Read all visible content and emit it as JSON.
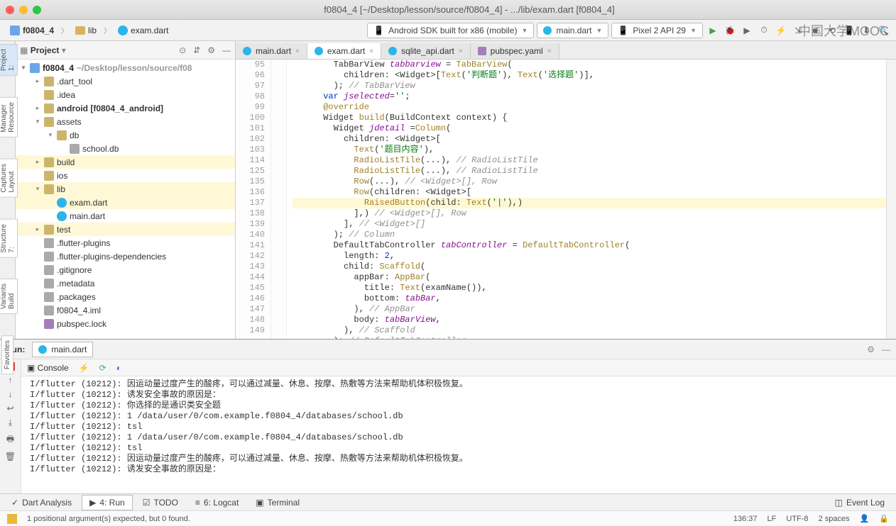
{
  "titlebar": "f0804_4 [~/Desktop/lesson/source/f0804_4] - .../lib/exam.dart [f0804_4]",
  "breadcrumbs": [
    "f0804_4",
    "lib",
    "exam.dart"
  ],
  "device_combo": "Android SDK built for x86 (mobile)",
  "run_config": "main.dart",
  "avd": "Pixel 2 API 29",
  "watermark": "中国大学MOOC",
  "project": {
    "title": "Project",
    "root_name": "f0804_4",
    "root_path": "~/Desktop/lesson/source/f08",
    "items": [
      {
        "indent": 1,
        "tw": "▸",
        "icon": "fld",
        "label": ".dart_tool"
      },
      {
        "indent": 1,
        "tw": "",
        "icon": "fld",
        "label": ".idea"
      },
      {
        "indent": 1,
        "tw": "▸",
        "icon": "fld",
        "label": "android [f0804_4_android]",
        "bold": true
      },
      {
        "indent": 1,
        "tw": "▾",
        "icon": "fld",
        "label": "assets"
      },
      {
        "indent": 2,
        "tw": "▾",
        "icon": "fld",
        "label": "db"
      },
      {
        "indent": 3,
        "tw": "",
        "icon": "pkg",
        "label": "school.db"
      },
      {
        "indent": 1,
        "tw": "▸",
        "icon": "fld",
        "label": "build",
        "hl": true
      },
      {
        "indent": 1,
        "tw": "",
        "icon": "fld",
        "label": "ios"
      },
      {
        "indent": 1,
        "tw": "▾",
        "icon": "fld",
        "label": "lib",
        "hl": true
      },
      {
        "indent": 2,
        "tw": "",
        "icon": "drt",
        "label": "exam.dart",
        "hl": true
      },
      {
        "indent": 2,
        "tw": "",
        "icon": "drt",
        "label": "main.dart"
      },
      {
        "indent": 1,
        "tw": "▸",
        "icon": "fld",
        "label": "test",
        "hl": true
      },
      {
        "indent": 1,
        "tw": "",
        "icon": "pkg",
        "label": ".flutter-plugins"
      },
      {
        "indent": 1,
        "tw": "",
        "icon": "pkg",
        "label": ".flutter-plugins-dependencies"
      },
      {
        "indent": 1,
        "tw": "",
        "icon": "pkg",
        "label": ".gitignore"
      },
      {
        "indent": 1,
        "tw": "",
        "icon": "pkg",
        "label": ".metadata"
      },
      {
        "indent": 1,
        "tw": "",
        "icon": "pkg",
        "label": ".packages"
      },
      {
        "indent": 1,
        "tw": "",
        "icon": "pkg",
        "label": "f0804_4.iml"
      },
      {
        "indent": 1,
        "tw": "",
        "icon": "yml",
        "label": "pubspec.lock"
      }
    ]
  },
  "editor_tabs": [
    {
      "icon": "drt",
      "label": "main.dart"
    },
    {
      "icon": "drt",
      "label": "exam.dart",
      "active": true
    },
    {
      "icon": "drt",
      "label": "sqlite_api.dart"
    },
    {
      "icon": "yml",
      "label": "pubspec.yaml"
    }
  ],
  "code_lines": [
    {
      "n": "",
      "html": "        TabBarView <span class='id'>tabbarview</span> = <span class='type'>TabBarView</span>("
    },
    {
      "n": "95",
      "html": "          children: &lt;Widget&gt;[<span class='type'>Text</span>(<span class='str'>'判断题'</span>), <span class='type'>Text</span>(<span class='str'>'选择题'</span>)],"
    },
    {
      "n": "96",
      "html": "        ); <span class='cmt'>// TabBarView</span>"
    },
    {
      "n": "97",
      "html": "      <span class='kw'>var</span> <span class='id'>jselected</span>=<span class='str'>''</span>;"
    },
    {
      "n": "98",
      "html": "      <span class='fn'>@override</span>"
    },
    {
      "n": "99",
      "html": "      Widget <span class='fn'>build</span>(BuildContext context) {"
    },
    {
      "n": "100",
      "html": "        Widget <span class='id'>jdetail</span> =<span class='type'>Column</span>("
    },
    {
      "n": "101",
      "html": "          children: &lt;Widget&gt;["
    },
    {
      "n": "102",
      "html": "            <span class='type'>Text</span>(<span class='str'>'题目内容'</span>),"
    },
    {
      "n": "103",
      "html": "            <span class='type'>RadioListTile</span>(...), <span class='cmt'>// RadioListTile</span>"
    },
    {
      "n": "114",
      "html": "            <span class='type'>RadioListTile</span>(...), <span class='cmt'>// RadioListTile</span>"
    },
    {
      "n": "125",
      "html": "            <span class='type'>Row</span>(...), <span class='cmt'>// &lt;Widget&gt;[], Row</span>"
    },
    {
      "n": "135",
      "html": "            <span class='type'>Row</span>(children: &lt;Widget&gt;["
    },
    {
      "n": "136",
      "html": "              <span class='type'>RaisedButton</span>(child: <span class='type'>Text</span>(<span class='str'>'|'</span>),)",
      "hl": true
    },
    {
      "n": "137",
      "html": "            ],) <span class='cmt'>// &lt;Widget&gt;[], Row</span>"
    },
    {
      "n": "138",
      "html": "          ], <span class='cmt'>// &lt;Widget&gt;[]</span>"
    },
    {
      "n": "139",
      "html": "        ); <span class='cmt'>// Column</span>"
    },
    {
      "n": "140",
      "html": "        DefaultTabController <span class='id'>tabController</span> = <span class='type'>DefaultTabController</span>("
    },
    {
      "n": "141",
      "html": "          length: <span class='kw'>2</span>,"
    },
    {
      "n": "142",
      "html": "          child: <span class='type'>Scaffold</span>("
    },
    {
      "n": "143",
      "html": "            appBar: <span class='type'>AppBar</span>("
    },
    {
      "n": "144",
      "html": "              title: <span class='type'>Text</span>(examName()),"
    },
    {
      "n": "145",
      "html": "              bottom: <span class='id'>tabBar</span>,"
    },
    {
      "n": "146",
      "html": "            ), <span class='cmt'>// AppBar</span>"
    },
    {
      "n": "147",
      "html": "            body: <span class='id'>tabBarView</span>,"
    },
    {
      "n": "148",
      "html": "          ), <span class='cmt'>// Scaffold</span>"
    },
    {
      "n": "149",
      "html": "        ); <span class='cmt'>// DefaultTabController</span>"
    }
  ],
  "run": {
    "label": "Run:",
    "tab": "main.dart",
    "console_label": "Console",
    "lines": [
      "I/flutter (10212): 因运动量过度产生的酸疼，可以通过减量、休息、按摩、热敷等方法来帮助机体积极恢复。",
      "I/flutter (10212): 诱发安全事故的原因是：",
      "I/flutter (10212): 你选择的是通识类安全题",
      "I/flutter (10212): 1 /data/user/0/com.example.f0804_4/databases/school.db",
      "I/flutter (10212): tsl",
      "I/flutter (10212): 1 /data/user/0/com.example.f0804_4/databases/school.db",
      "I/flutter (10212): tsl",
      "I/flutter (10212): 因运动量过度产生的酸疼，可以通过减量、休息、按摩、热敷等方法来帮助机体积极恢复。",
      "I/flutter (10212): 诱发安全事故的原因是："
    ]
  },
  "bottom": {
    "tabs": [
      "Dart Analysis",
      "4: Run",
      "TODO",
      "6: Logcat",
      "Terminal"
    ],
    "event_log": "Event Log"
  },
  "status": {
    "msg": "1 positional argument(s) expected, but 0 found.",
    "pos": "136:37",
    "lf": "LF",
    "enc": "UTF-8",
    "spaces": "2 spaces"
  },
  "left_tabs": [
    "1: Project",
    "Resource Manager",
    "Layout Captures",
    "7: Structure",
    "Build Variants",
    "Favorites"
  ]
}
